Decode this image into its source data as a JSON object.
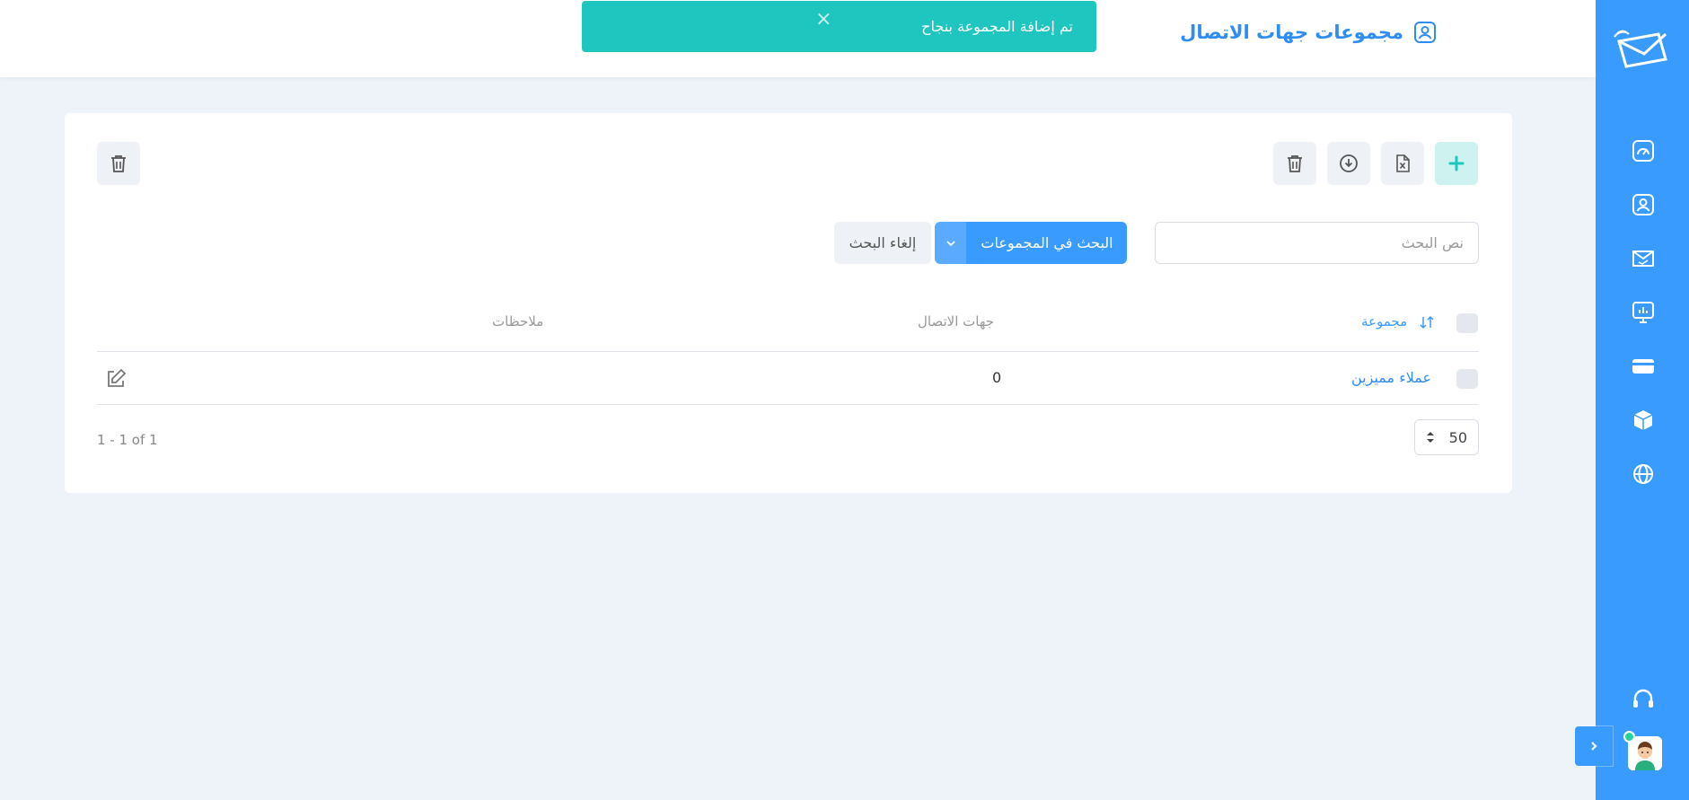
{
  "header": {
    "title": "مجموعات جهات الاتصال"
  },
  "toast": {
    "message": "تم إضافة المجموعة بنجاح",
    "close": "×"
  },
  "toolbar": {
    "add": "plus-icon",
    "export_excel": "excel-icon",
    "download": "download-icon",
    "delete": "trash-icon",
    "delete_all": "trash-icon"
  },
  "search": {
    "placeholder": "نص البحث",
    "button": "البحث في المجموعات",
    "cancel": "إلغاء البحث"
  },
  "table": {
    "columns": {
      "group": "مجموعة",
      "contacts": "جهات الاتصال",
      "notes": "ملاحظات"
    },
    "rows": [
      {
        "group": "عملاء مميزين",
        "contacts": "0",
        "notes": ""
      }
    ]
  },
  "pagination": {
    "per_page": "50",
    "info": "1 - 1 of 1"
  },
  "colors": {
    "primary": "#3a9bff",
    "toast": "#1fc5bf",
    "background": "#eef3fa"
  },
  "sidebar": {
    "items": [
      "dashboard-icon",
      "contacts-icon",
      "messages-icon",
      "reports-icon",
      "billing-icon",
      "packages-icon",
      "language-icon",
      "support-icon"
    ]
  }
}
